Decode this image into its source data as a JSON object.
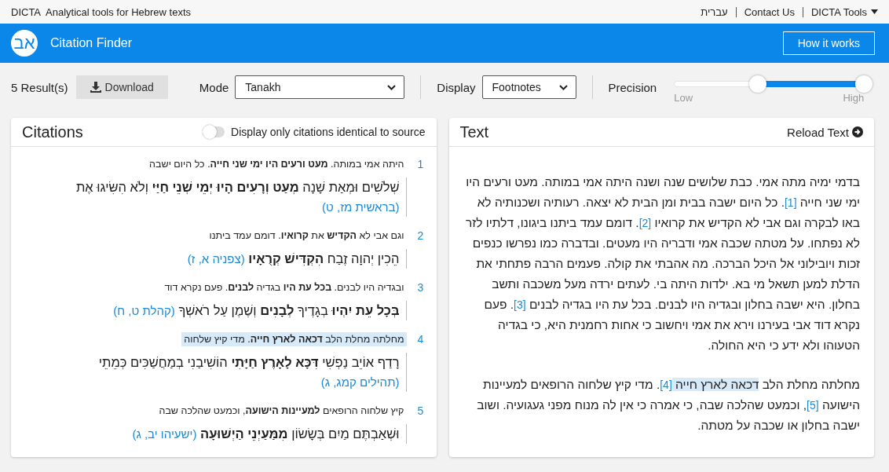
{
  "top_bar": {
    "brand": "DICTA",
    "tagline": "Analytical tools for Hebrew texts",
    "language_link": "עברית",
    "contact_link": "Contact Us",
    "tools_menu": "DICTA Tools"
  },
  "header": {
    "logo_text": "אב",
    "title": "Citation Finder",
    "button": "How it works"
  },
  "toolbar": {
    "results": "5 Result(s)",
    "download": "Download",
    "mode": {
      "label": "Mode",
      "value": "Tanakh"
    },
    "display": {
      "label": "Display",
      "value": "Footnotes"
    },
    "precision": {
      "label": "Precision",
      "low": "Low",
      "high": "High",
      "thumbs": [
        {
          "level": 0.44
        },
        {
          "level": 1
        }
      ]
    }
  },
  "citations": {
    "title": "Citations",
    "toggle": {
      "label": "Display only citations identical to source",
      "on": false
    },
    "items": [
      {
        "number": "1",
        "selected": false,
        "context": "היתה אמי במותה. **מעט ורעים היו ימי שני חייה**. כל היום ישבה",
        "verse": "שְׁלֹשִׁים וּמְאַת שָׁנָה **מְעַט וְרָעִים הָיוּ יְמֵי שְׁנֵי חַיַּי** וְלֹא הִשִּׂיגוּ אֶת",
        "reference": "(בראשית מז, ט)"
      },
      {
        "number": "2",
        "selected": false,
        "context": "וגם אבי לא **הקדיש** את **קרואיו**. דומם עמד ביתנו",
        "verse": "הֵכִין יְהוָה זֶבַח **הִקְדִּישׁ קְרֻאָיו**",
        "reference": "(צפניה א, ז)"
      },
      {
        "number": "3",
        "selected": false,
        "context": "ובגדיה היו לבנים. **בכל עת היו** בגדיה **לבנים**. פעם נקרא דוד",
        "verse": "**בְּכָל עֵת יִהְיוּ** בְגָדֶיךָ **לְבָנִים** וְשֶׁמֶן עַל רֹאשְׁךָ",
        "reference": "(קהלת ט, ח)"
      },
      {
        "number": "4",
        "selected": true,
        "context": "מחלתה מחלת הלב **דכאה לארץ חייה**. מדי קיץ שלחוה",
        "verse": "רָדַף אוֹיֵב נַפְשִׁי **דִּכָּא לָאָרֶץ חַיָּתִי** הוֹשִׁיבַנִי בְמַחֲשַׁכִּים כְּמֵתֵי",
        "reference": "(תהילים קמג, ג)"
      },
      {
        "number": "5",
        "selected": false,
        "context": "קיץ שלחוה הרופאים **למעיינות הישועה**, וכמעט שהלכה שבה",
        "verse": "וּשְׁאַבְתֶּם מַיִם בְּשָׂשׂוֹן **מִמַּעַיְנֵי הַיְשׁוּעָה**",
        "reference": "(ישעיהו יב, ג)"
      }
    ]
  },
  "text_panel": {
    "title": "Text",
    "reload": "Reload Text",
    "paragraphs": [
      [
        {
          "kind": "text",
          "text": "בדמי ימיה מתה אמי. כבת שלושים שנה ושנה היתה אמי במותה. מעט ורעים היו ימי שני חייה "
        },
        {
          "kind": "footnote",
          "text": "[1]"
        },
        {
          "kind": "text",
          "text": ". כל היום ישבה בבית ומן הבית לא יצאה. רעותיה ושכנותיה לא באו לבקרה וגם אבי לא הקדיש את קרואיו "
        },
        {
          "kind": "footnote",
          "text": "[2]"
        },
        {
          "kind": "text",
          "text": ". דומם עמד ביתנו ביגונו, דלתיו לזר לא נפתחו. על מטתה שכבה אמי ודבריה היו מעטים. ובדברה כמו נפרשו כנפים זכות ויובילוני אל היכל הברכה. מה אהבתי את קולה. פעמים הרבה פתחתי את הדלת למען תשאל מי בא. ילדות היתה בי. לעתים ירדה מעל משכבה ותשב בחלון. היא ישבה בחלון ובגדיה היו לבנים. בכל עת היו בגדיה לבנים "
        },
        {
          "kind": "footnote",
          "text": "[3]"
        },
        {
          "kind": "text",
          "text": ". פעם נקרא דוד אבי בעירנו וירא את אמי ויחשוב כי אחות רחמנית היא, כי בגדיה הטעוהו ולא ידע כי היא החולה."
        }
      ],
      [
        {
          "kind": "text",
          "text": "מחלתה מחלת הלב "
        },
        {
          "kind": "highlight",
          "text": "דכאה לארץ חייה "
        },
        {
          "kind": "footnote",
          "text": "[4]"
        },
        {
          "kind": "text",
          "text": ". מדי קיץ שלחוה הרופאים למעיינות הישועה "
        },
        {
          "kind": "footnote",
          "text": "[5]"
        },
        {
          "kind": "text",
          "text": ", וכמעט שהלכה שבה, כי אמרה כי אין לה מנוח מפני געגועיה. ושוב ישבה בחלון או שכבה על מטתה."
        }
      ]
    ]
  }
}
